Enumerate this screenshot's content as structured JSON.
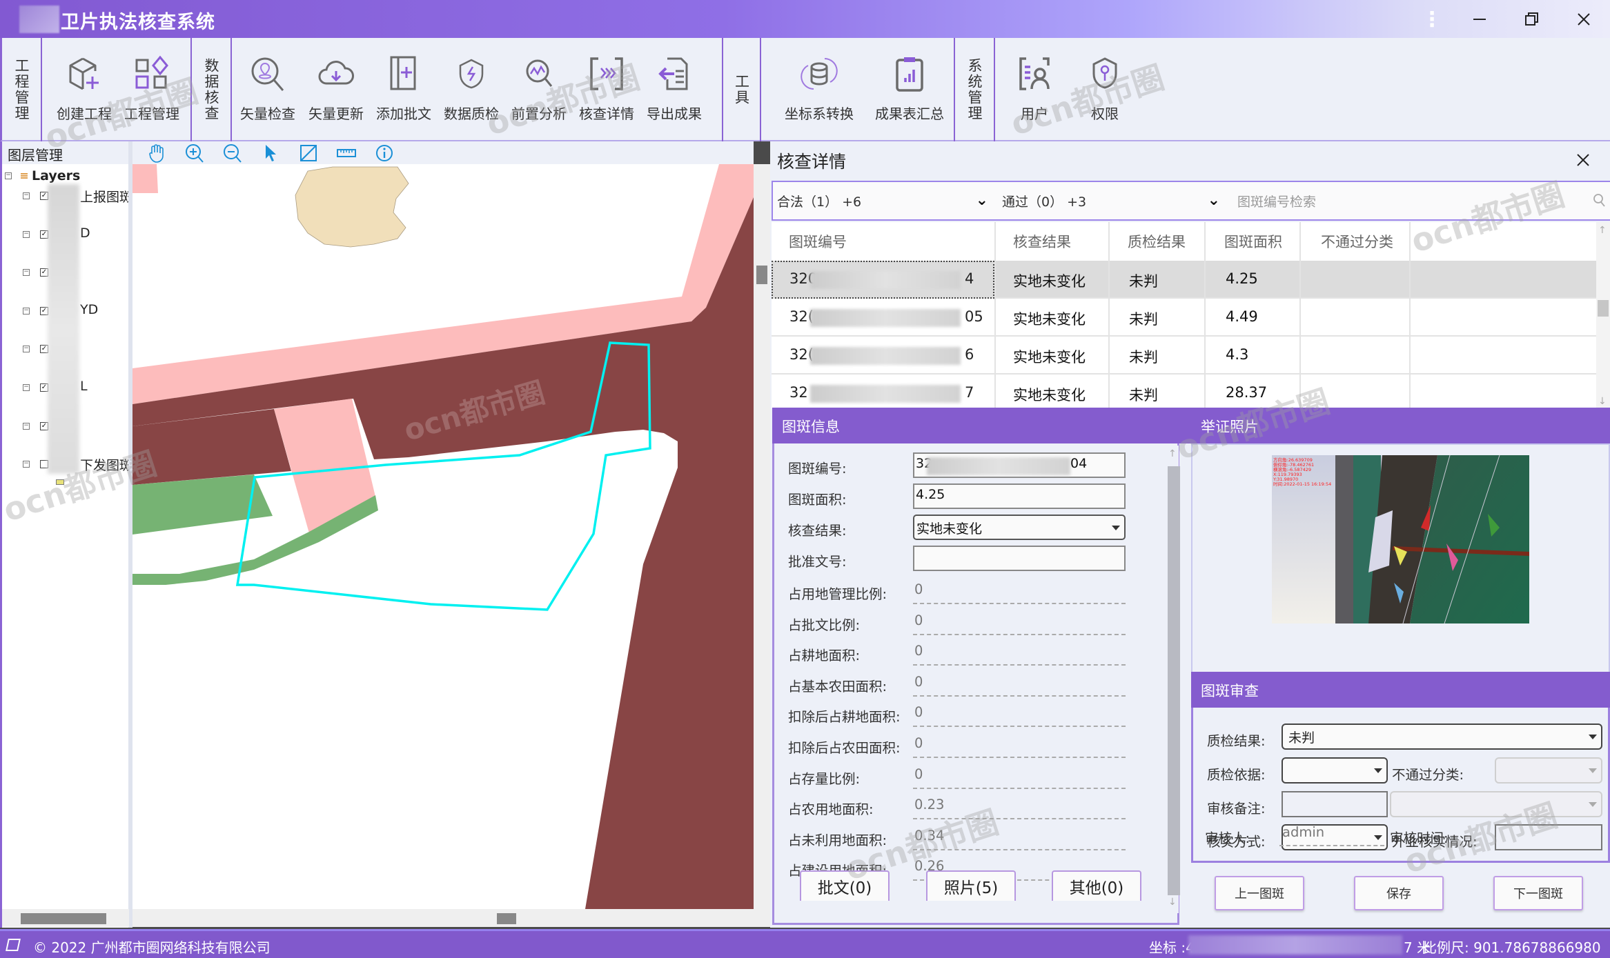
{
  "window": {
    "title": "卫片执法核查系统",
    "controls": {
      "more": "⋮",
      "minimize": "—",
      "restore": "❐",
      "close": "✕"
    }
  },
  "toolbar": {
    "groups": [
      {
        "label": "工程管理",
        "buttons": [
          {
            "label": "创建工程",
            "icon": "cube-add-icon"
          },
          {
            "label": "工程管理",
            "icon": "grid-manage-icon"
          }
        ]
      },
      {
        "label": "数据核查",
        "buttons": [
          {
            "label": "矢量检查",
            "icon": "map-search-icon"
          },
          {
            "label": "矢量更新",
            "icon": "cloud-download-icon"
          },
          {
            "label": "添加批文",
            "icon": "add-document-icon"
          },
          {
            "label": "数据质检",
            "icon": "shield-bolt-icon"
          },
          {
            "label": "前置分析",
            "icon": "analysis-search-icon"
          },
          {
            "label": "核查详情",
            "icon": "scan-detail-icon"
          },
          {
            "label": "导出成果",
            "icon": "export-icon"
          }
        ]
      },
      {
        "label": "工具",
        "buttons": [
          {
            "label": "坐标系转换",
            "icon": "database-sync-icon"
          },
          {
            "label": "成果表汇总",
            "icon": "clipboard-chart-icon"
          }
        ]
      },
      {
        "label": "系统管理",
        "buttons": [
          {
            "label": "用户",
            "icon": "user-list-icon"
          },
          {
            "label": "权限",
            "icon": "shield-key-icon"
          }
        ]
      }
    ]
  },
  "layer_panel": {
    "title": "图层管理",
    "root": "Layers",
    "layers": [
      {
        "name_visible": "上报图斑",
        "checked": true
      },
      {
        "name_visible": "D",
        "checked": true
      },
      {
        "name_visible": "",
        "checked": true
      },
      {
        "name_visible": "YD",
        "checked": true
      },
      {
        "name_visible": "",
        "checked": true
      },
      {
        "name_visible": "L",
        "checked": true
      },
      {
        "name_visible": "",
        "checked": true
      },
      {
        "name_visible": "下发图斑",
        "checked": false
      }
    ]
  },
  "map_tools": [
    "pan-hand-icon",
    "zoom-in-icon",
    "zoom-out-icon",
    "select-arrow-icon",
    "full-extent-icon",
    "measure-ruler-icon",
    "info-icon"
  ],
  "map": {
    "colors": {
      "road_pink": "#fdbcbc",
      "building_brown": "#884545",
      "green": "#76b373",
      "beige": "#f1dfba",
      "selected_outline": "#00f0f0"
    }
  },
  "detail": {
    "title": "核查详情",
    "close": "✕",
    "filters": [
      {
        "label": "合法（1）  +6"
      },
      {
        "label": "通过（0）  +3"
      }
    ],
    "search_placeholder": "图斑编号检索",
    "table": {
      "columns": [
        "图斑编号",
        "核查结果",
        "质检结果",
        "图斑面积",
        "不通过分类"
      ],
      "rows": [
        {
          "id_prefix": "320",
          "id_suffix": "4",
          "result": "实地未变化",
          "qc": "未判",
          "area": "4.25",
          "fail_class": "",
          "selected": true
        },
        {
          "id_prefix": "32(",
          "id_suffix": "05",
          "result": "实地未变化",
          "qc": "未判",
          "area": "4.49",
          "fail_class": ""
        },
        {
          "id_prefix": "32(",
          "id_suffix": "6",
          "result": "实地未变化",
          "qc": "未判",
          "area": "4.3",
          "fail_class": ""
        },
        {
          "id_prefix": "32",
          "id_suffix": "7",
          "result": "实地未变化",
          "qc": "未判",
          "area": "28.37",
          "fail_class": ""
        }
      ]
    }
  },
  "info": {
    "title": "图斑信息",
    "fields": {
      "id": {
        "label": "图斑编号:",
        "prefix": "32",
        "suffix": "04"
      },
      "area": {
        "label": "图斑面积:",
        "value": "4.25"
      },
      "result": {
        "label": "核查结果:",
        "value": "实地未变化"
      },
      "approval_no": {
        "label": "批准文号:",
        "value": ""
      }
    },
    "readonly": [
      {
        "label": "占用地管理比例:",
        "value": "0"
      },
      {
        "label": "占批文比例:",
        "value": "0"
      },
      {
        "label": "占耕地面积:",
        "value": "0"
      },
      {
        "label": "占基本农田面积:",
        "value": "0"
      },
      {
        "label": "扣除后占耕地面积:",
        "value": "0"
      },
      {
        "label": "扣除后占农田面积:",
        "value": "0"
      },
      {
        "label": "占存量比例:",
        "value": "0"
      },
      {
        "label": "占农用地面积:",
        "value": "0.23"
      },
      {
        "label": "占未利用地面积:",
        "value": "0.34"
      },
      {
        "label": "占建设用地面积:",
        "value": "0.26"
      }
    ],
    "attachments": [
      "批文(0)",
      "照片(5)",
      "其他(0)"
    ]
  },
  "photo": {
    "title": "举证照片",
    "overlay": [
      "方向角:26.639709",
      "俯仰角:-78.462761",
      "横滚角:-6.587429",
      "X:119.79393",
      "Y:31.98970",
      "时间:2022-01-15 16:19:54"
    ]
  },
  "review": {
    "title": "图斑审查",
    "qc_result": {
      "label": "质检结果:",
      "value": "未判"
    },
    "qc_basis": {
      "label": "质检依据:",
      "value": ""
    },
    "fail_class": {
      "label": "不通过分类:",
      "value": ""
    },
    "remark": {
      "label": "审核备注:",
      "value": ""
    },
    "verify_method": {
      "label": "核实方式:",
      "value": ""
    },
    "field_status": {
      "label": "外业核实情况:",
      "value": ""
    },
    "reviewer": {
      "label": "审核人:",
      "value": "admin"
    },
    "review_time": {
      "label": "审核时间:",
      "value": ""
    },
    "buttons": {
      "prev": "上一图斑",
      "save": "保存",
      "next": "下一图斑"
    }
  },
  "status": {
    "copyright": "© 2022 广州都市圈网络科技有限公司",
    "coord_label": "坐标 :4",
    "coord_tail": "7 米",
    "scale": "比例尺:  901.78678866980"
  }
}
